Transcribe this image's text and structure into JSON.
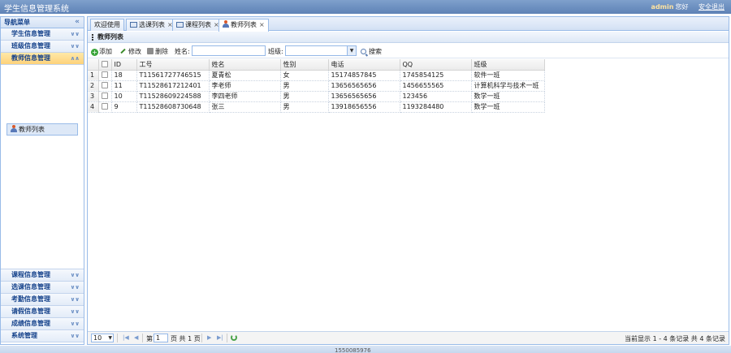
{
  "header": {
    "title": "学生信息管理系统",
    "username": "admin",
    "greeting": "您好",
    "logout": "安全退出"
  },
  "sidebar": {
    "title": "导航菜单",
    "collapse_icon": "«",
    "groups_top": [
      {
        "label": "学生信息管理"
      },
      {
        "label": "班级信息管理"
      },
      {
        "label": "教师信息管理",
        "active": true
      }
    ],
    "sub_item": "教师列表",
    "groups_bottom": [
      {
        "label": "课程信息管理"
      },
      {
        "label": "选课信息管理"
      },
      {
        "label": "考勤信息管理"
      },
      {
        "label": "请假信息管理"
      },
      {
        "label": "成绩信息管理"
      },
      {
        "label": "系统管理"
      }
    ]
  },
  "tabs": [
    {
      "label": "欢迎使用",
      "icon": "",
      "closable": false
    },
    {
      "label": "选课列表",
      "icon": "window-icon",
      "closable": true
    },
    {
      "label": "课程列表",
      "icon": "window-icon",
      "closable": true
    },
    {
      "label": "教师列表",
      "icon": "person-icon",
      "closable": true,
      "active": true
    }
  ],
  "panel_title": "教师列表",
  "toolbar": {
    "add": "添加",
    "edit": "修改",
    "delete": "删除",
    "name_label": "姓名:",
    "name_value": "",
    "class_label": "班级:",
    "class_value": "",
    "search": "搜索"
  },
  "grid": {
    "columns": [
      "ID",
      "工号",
      "姓名",
      "性别",
      "电话",
      "QQ",
      "班级"
    ],
    "rows": [
      {
        "num": "1",
        "id": "18",
        "no": "T11561727746515",
        "name": "夏青松",
        "sex": "女",
        "phone": "15174857845",
        "qq": "1745854125",
        "cls": "软件一班"
      },
      {
        "num": "2",
        "id": "11",
        "no": "T11528617212401",
        "name": "李老师",
        "sex": "男",
        "phone": "13656565656",
        "qq": "1456655565",
        "cls": "计算机科学与技术一班"
      },
      {
        "num": "3",
        "id": "10",
        "no": "T11528609224588",
        "name": "李四老师",
        "sex": "男",
        "phone": "13656565656",
        "qq": "123456",
        "cls": "数学一班"
      },
      {
        "num": "4",
        "id": "9",
        "no": "T11528608730648",
        "name": "张三",
        "sex": "男",
        "phone": "13918656556",
        "qq": "1193284480",
        "cls": "数学一班"
      }
    ]
  },
  "pager": {
    "page_size": "10",
    "page_label_pre": "第",
    "page_value": "1",
    "page_label_post": "页 共 1 页",
    "summary": "当前显示 1 - 4 条记录 共 4 条记录"
  },
  "footer": {
    "text": "1550085976"
  }
}
